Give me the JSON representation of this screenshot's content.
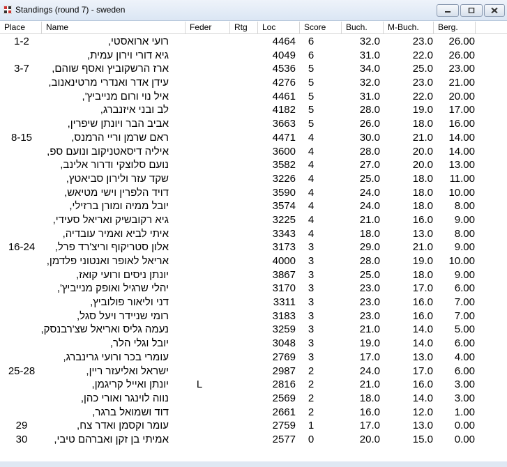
{
  "window": {
    "title": "Standings  (round 7) - sweden"
  },
  "columns": {
    "place": "Place",
    "name": "Name",
    "feder": "Feder",
    "rtg": "Rtg",
    "loc": "Loc",
    "score": "Score",
    "buch": "Buch.",
    "mbuch": "M-Buch.",
    "berg": "Berg."
  },
  "rows": [
    {
      "place": "1-2",
      "name": "רועי ארואסטי,",
      "feder": "",
      "loc": "4464",
      "score": "6",
      "buch": "32.0",
      "mbuch": "23.0",
      "berg": "26.00"
    },
    {
      "place": "",
      "name": "גיא דורי וירון עמית,",
      "feder": "",
      "loc": "4049",
      "score": "6",
      "buch": "31.0",
      "mbuch": "22.0",
      "berg": "26.00"
    },
    {
      "place": "3-7",
      "name": "ארז הרשקוביץ ואסף שוהם,",
      "feder": "",
      "loc": "4536",
      "score": "5",
      "buch": "34.0",
      "mbuch": "25.0",
      "berg": "23.00"
    },
    {
      "place": "",
      "name": "עידן אדר ואנדרי מרטינאנוב,",
      "feder": "",
      "loc": "4276",
      "score": "5",
      "buch": "32.0",
      "mbuch": "23.0",
      "berg": "21.00"
    },
    {
      "place": "",
      "name": "איל נוי ורום מנייביץ',",
      "feder": "",
      "loc": "4461",
      "score": "5",
      "buch": "31.0",
      "mbuch": "22.0",
      "berg": "20.00"
    },
    {
      "place": "",
      "name": "לב ובני איזנברג,",
      "feder": "",
      "loc": "4182",
      "score": "5",
      "buch": "28.0",
      "mbuch": "19.0",
      "berg": "17.00"
    },
    {
      "place": "",
      "name": "אביב הבר ויונתן שיפרין,",
      "feder": "",
      "loc": "3663",
      "score": "5",
      "buch": "26.0",
      "mbuch": "18.0",
      "berg": "16.00"
    },
    {
      "place": "8-15",
      "name": "ראם שרמן וריי הרמנס,",
      "feder": "",
      "loc": "4471",
      "score": "4",
      "buch": "30.0",
      "mbuch": "21.0",
      "berg": "14.00"
    },
    {
      "place": "",
      "name": "איליה דיסאטניקוב ונועם ספ,",
      "feder": "",
      "loc": "3600",
      "score": "4",
      "buch": "28.0",
      "mbuch": "20.0",
      "berg": "14.00"
    },
    {
      "place": "",
      "name": "נועם סלוצקי ודרור אלינב,",
      "feder": "",
      "loc": "3582",
      "score": "4",
      "buch": "27.0",
      "mbuch": "20.0",
      "berg": "13.00"
    },
    {
      "place": "",
      "name": "שקד עזר ולירון סביאטץ,",
      "feder": "",
      "loc": "3226",
      "score": "4",
      "buch": "25.0",
      "mbuch": "18.0",
      "berg": "11.00"
    },
    {
      "place": "",
      "name": "דויד הלפרין וישי מטיאש,",
      "feder": "",
      "loc": "3590",
      "score": "4",
      "buch": "24.0",
      "mbuch": "18.0",
      "berg": "10.00"
    },
    {
      "place": "",
      "name": "יובל ממיה ומורן ברזילי,",
      "feder": "",
      "loc": "3574",
      "score": "4",
      "buch": "24.0",
      "mbuch": "18.0",
      "berg": "8.00"
    },
    {
      "place": "",
      "name": "גיא רקובשיק ואריאל סעידי,",
      "feder": "",
      "loc": "3225",
      "score": "4",
      "buch": "21.0",
      "mbuch": "16.0",
      "berg": "9.00"
    },
    {
      "place": "",
      "name": "איתי לביא ואמיר עובדיה,",
      "feder": "",
      "loc": "3343",
      "score": "4",
      "buch": "18.0",
      "mbuch": "13.0",
      "berg": "8.00"
    },
    {
      "place": "16-24",
      "name": "אלון סטריקוף וריצ'רד פרל,",
      "feder": "",
      "loc": "3173",
      "score": "3",
      "buch": "29.0",
      "mbuch": "21.0",
      "berg": "9.00"
    },
    {
      "place": "",
      "name": "אריאל לאופר ואנטוני פלדמן,",
      "feder": "",
      "loc": "4000",
      "score": "3",
      "buch": "28.0",
      "mbuch": "19.0",
      "berg": "10.00"
    },
    {
      "place": "",
      "name": "יונתן ניסים ורועי קואז,",
      "feder": "",
      "loc": "3867",
      "score": "3",
      "buch": "25.0",
      "mbuch": "18.0",
      "berg": "9.00"
    },
    {
      "place": "",
      "name": "יהלי שרגיל ואופק מנייביץ',",
      "feder": "",
      "loc": "3170",
      "score": "3",
      "buch": "23.0",
      "mbuch": "17.0",
      "berg": "6.00"
    },
    {
      "place": "",
      "name": "דני וליאור פולוביץ,",
      "feder": "",
      "loc": "3311",
      "score": "3",
      "buch": "23.0",
      "mbuch": "16.0",
      "berg": "7.00"
    },
    {
      "place": "",
      "name": "רומי שניידר ויעל סגל,",
      "feder": "",
      "loc": "3183",
      "score": "3",
      "buch": "23.0",
      "mbuch": "16.0",
      "berg": "7.00"
    },
    {
      "place": "",
      "name": "נעמה גליס ואריאל שצ'רבנסק,",
      "feder": "",
      "loc": "3259",
      "score": "3",
      "buch": "21.0",
      "mbuch": "14.0",
      "berg": "5.00"
    },
    {
      "place": "",
      "name": "יובל וגלי הלר,",
      "feder": "",
      "loc": "3048",
      "score": "3",
      "buch": "19.0",
      "mbuch": "14.0",
      "berg": "6.00"
    },
    {
      "place": "",
      "name": "עומרי בכר ורועי גרינברג,",
      "feder": "",
      "loc": "2769",
      "score": "3",
      "buch": "17.0",
      "mbuch": "13.0",
      "berg": "4.00"
    },
    {
      "place": "25-28",
      "name": "ישראל ואליעזר ריין,",
      "feder": "",
      "loc": "2987",
      "score": "2",
      "buch": "24.0",
      "mbuch": "17.0",
      "berg": "6.00"
    },
    {
      "place": "",
      "name": "יונתן ואייל קריגמן,",
      "feder": "L",
      "loc": "2816",
      "score": "2",
      "buch": "21.0",
      "mbuch": "16.0",
      "berg": "3.00"
    },
    {
      "place": "",
      "name": "נווה לוינגר ואורי כהן,",
      "feder": "",
      "loc": "2569",
      "score": "2",
      "buch": "18.0",
      "mbuch": "14.0",
      "berg": "3.00"
    },
    {
      "place": "",
      "name": "דוד ושמואל ברגר,",
      "feder": "",
      "loc": "2661",
      "score": "2",
      "buch": "16.0",
      "mbuch": "12.0",
      "berg": "1.00"
    },
    {
      "place": "29",
      "name": "עומר וקסמן ואדר צח,",
      "feder": "",
      "loc": "2759",
      "score": "1",
      "buch": "17.0",
      "mbuch": "13.0",
      "berg": "0.00"
    },
    {
      "place": "30",
      "name": "אמיתי בן זקן ואברהם טיבי,",
      "feder": "",
      "loc": "2577",
      "score": "0",
      "buch": "20.0",
      "mbuch": "15.0",
      "berg": "0.00"
    }
  ]
}
